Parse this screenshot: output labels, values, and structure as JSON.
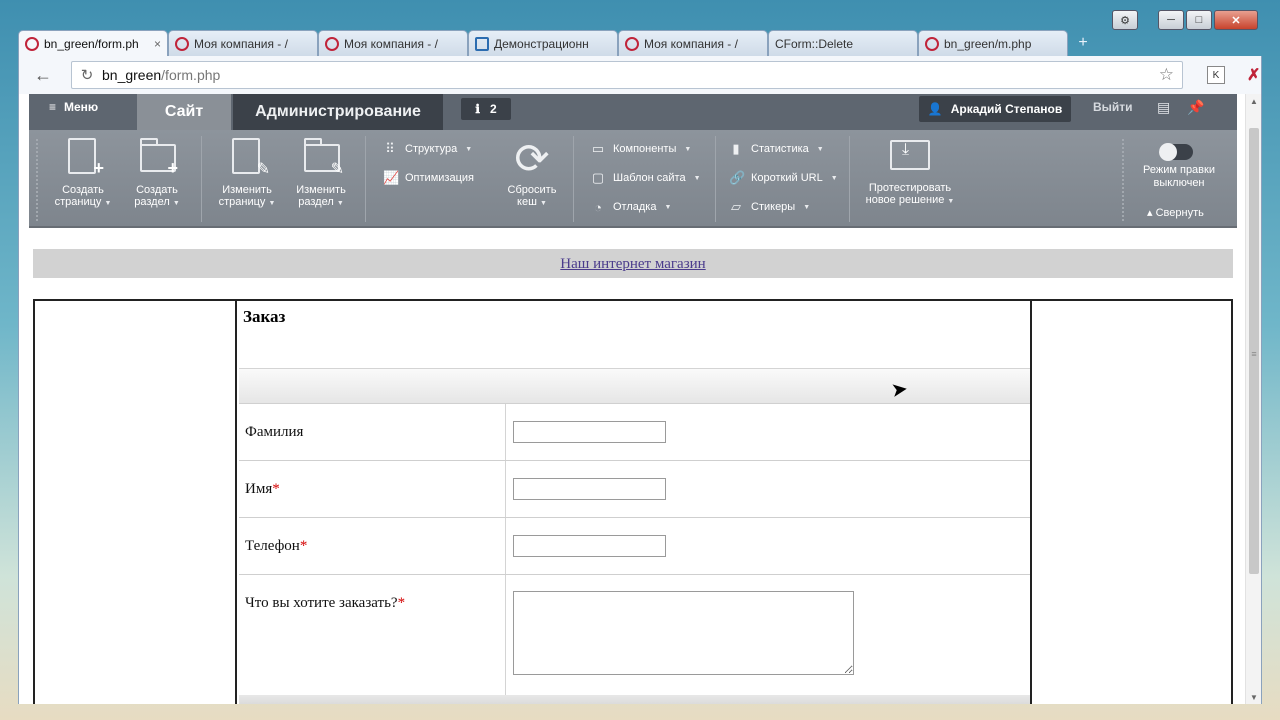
{
  "browser": {
    "tabs": [
      {
        "label": "bn_green/form.ph",
        "active": true,
        "favicon": "bitrix-icon",
        "close": "×"
      },
      {
        "label": "Моя компания - /",
        "active": false,
        "favicon": "bitrix-icon",
        "close": "×"
      },
      {
        "label": "Моя компания - /",
        "active": false,
        "favicon": "bitrix-icon",
        "close": "×"
      },
      {
        "label": "Демонстрационн",
        "active": false,
        "favicon": "doc-icon",
        "close": "×"
      },
      {
        "label": "Моя компания - /",
        "active": false,
        "favicon": "bitrix-icon",
        "close": "×"
      },
      {
        "label": "CForm::Delete",
        "active": false,
        "favicon": "none",
        "close": "×"
      },
      {
        "label": "bn_green/m.php",
        "active": false,
        "favicon": "bitrix-icon",
        "close": "×"
      }
    ],
    "new_tab": "+",
    "url_host": "bn_green",
    "url_path": "/form.php",
    "back_icon": "←",
    "reload_icon": "↻",
    "star_icon": "☆",
    "ext1_label": "K",
    "ext2_label": "✗",
    "settings_icon": "⚙",
    "minimize": "─",
    "maximize": "□",
    "close": "✕"
  },
  "panel": {
    "menu_label": "Меню",
    "tab_site": "Сайт",
    "tab_admin": "Администрирование",
    "notifications_count": "2",
    "user_name": "Аркадий Степанов",
    "logout": "Выйти",
    "create_page": [
      "Создать",
      "страницу"
    ],
    "create_section": [
      "Создать",
      "раздел"
    ],
    "edit_page": [
      "Изменить",
      "страницу"
    ],
    "edit_section": [
      "Изменить",
      "раздел"
    ],
    "structure": "Структура",
    "optimization": "Оптимизация",
    "clear_cache": [
      "Сбросить",
      "кеш"
    ],
    "components": "Компоненты",
    "site_template": "Шаблон сайта",
    "debug": "Отладка",
    "statistics": "Статистика",
    "short_url": "Короткий URL",
    "stickers": "Стикеры",
    "test_solution": [
      "Протестировать",
      "новое решение"
    ],
    "edit_mode": [
      "Режим правки",
      "выключен"
    ],
    "collapse": "Свернуть"
  },
  "site": {
    "store_link": "Наш интернет магазин"
  },
  "form": {
    "title": "Заказ",
    "fields": [
      {
        "label": "Фамилия",
        "required": false,
        "value": ""
      },
      {
        "label": "Имя",
        "required": true,
        "value": ""
      },
      {
        "label": "Телефон",
        "required": true,
        "value": ""
      },
      {
        "label": "Что вы хотите заказать?",
        "required": true,
        "value": ""
      }
    ],
    "required_mark": "*"
  },
  "colors": {
    "panel_dark": "#5e6670",
    "panel_tools": "#8d949c",
    "link": "#4a3b8c",
    "required": "#d40000"
  }
}
